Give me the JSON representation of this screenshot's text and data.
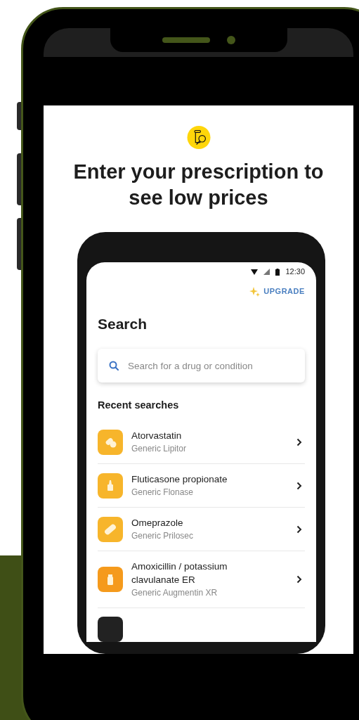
{
  "hero": {
    "title": "Enter your prescription to see low prices"
  },
  "status_bar": {
    "time": "12:30"
  },
  "upgrade": {
    "label": "UPGRADE"
  },
  "page": {
    "title": "Search"
  },
  "search": {
    "placeholder": "Search for a drug or condition"
  },
  "recent": {
    "heading": "Recent searches",
    "items": [
      {
        "name": "Atorvastatin",
        "subtitle": "Generic Lipitor",
        "kind": "pills"
      },
      {
        "name": "Fluticasone propionate",
        "subtitle": "Generic Flonase",
        "kind": "spray"
      },
      {
        "name": "Omeprazole",
        "subtitle": "Generic Prilosec",
        "kind": "capsule"
      },
      {
        "name": "Amoxicillin / potassium clavulanate ER",
        "subtitle": "Generic Augmentin XR",
        "kind": "bottle"
      }
    ]
  }
}
